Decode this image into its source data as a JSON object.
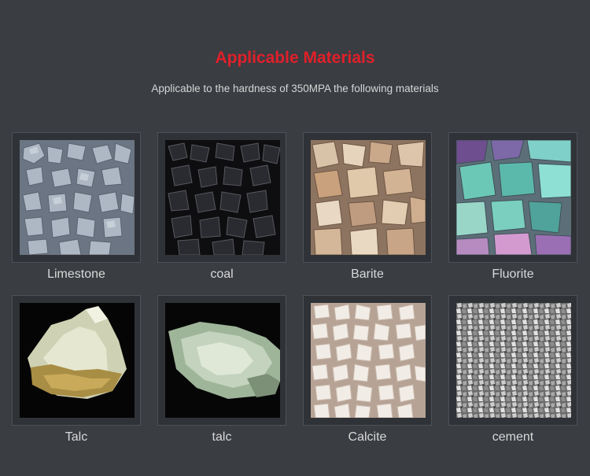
{
  "header": {
    "title": "Applicable Materials",
    "subtitle": "Applicable to the hardness of 350MPA the following materials"
  },
  "materials": [
    {
      "label": "Limestone"
    },
    {
      "label": "coal"
    },
    {
      "label": "Barite"
    },
    {
      "label": "Fluorite"
    },
    {
      "label": "Talc"
    },
    {
      "label": "talc"
    },
    {
      "label": "Calcite"
    },
    {
      "label": "cement"
    }
  ]
}
